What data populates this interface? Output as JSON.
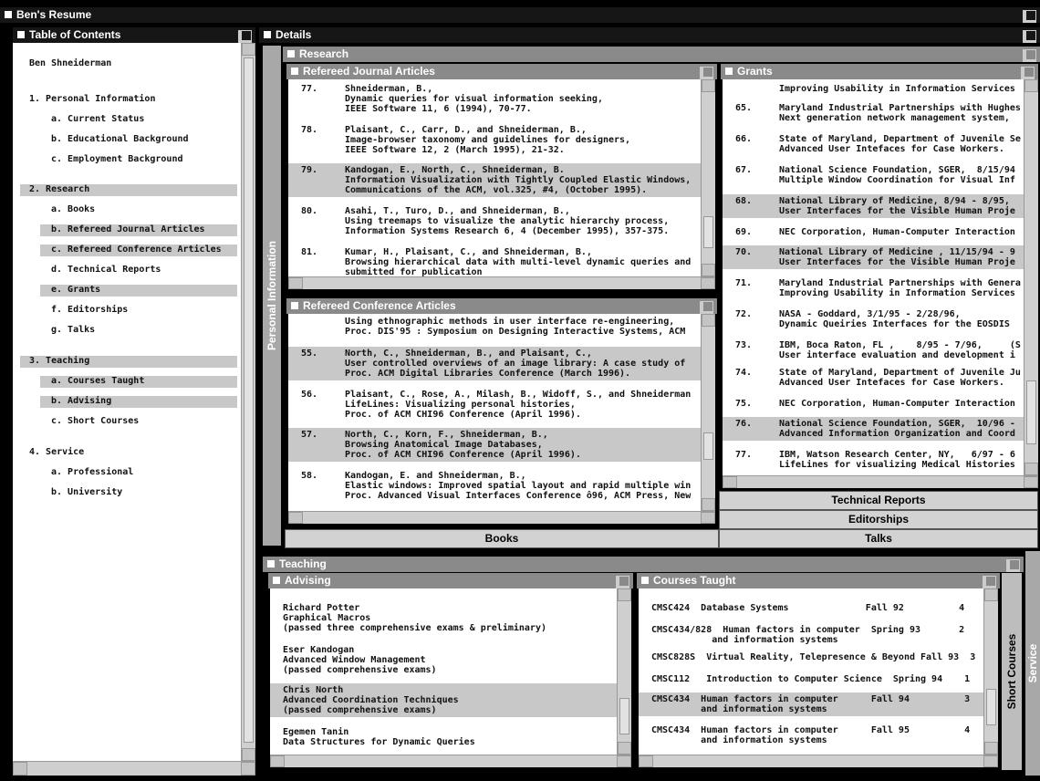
{
  "app": {
    "title": "Ben's Resume"
  },
  "toc": {
    "title": "Table of Contents",
    "name": "Ben Shneiderman",
    "items": [
      {
        "label": "1. Personal Information",
        "hl": false,
        "lvl": 0
      },
      {
        "label": "a. Current Status",
        "hl": false,
        "lvl": 1
      },
      {
        "label": "b. Educational Background",
        "hl": false,
        "lvl": 1
      },
      {
        "label": "c. Employment Background",
        "hl": false,
        "lvl": 1
      },
      {
        "label": "2. Research",
        "hl": true,
        "lvl": 0
      },
      {
        "label": "a. Books",
        "hl": false,
        "lvl": 1
      },
      {
        "label": "b. Refereed Journal Articles",
        "hl": true,
        "lvl": 1
      },
      {
        "label": "c. Refereed Conference Articles",
        "hl": true,
        "lvl": 1
      },
      {
        "label": "d. Technical Reports",
        "hl": false,
        "lvl": 1
      },
      {
        "label": "e. Grants",
        "hl": true,
        "lvl": 1
      },
      {
        "label": "f. Editorships",
        "hl": false,
        "lvl": 1
      },
      {
        "label": "g. Talks",
        "hl": false,
        "lvl": 1
      },
      {
        "label": "3. Teaching",
        "hl": true,
        "lvl": 0
      },
      {
        "label": "a. Courses Taught",
        "hl": true,
        "lvl": 1
      },
      {
        "label": "b. Advising",
        "hl": true,
        "lvl": 1
      },
      {
        "label": "c. Short Courses",
        "hl": false,
        "lvl": 1
      },
      {
        "label": "4. Service",
        "hl": false,
        "lvl": 0
      },
      {
        "label": "a. Professional",
        "hl": false,
        "lvl": 1
      },
      {
        "label": "b. University",
        "hl": false,
        "lvl": 1
      }
    ]
  },
  "details": {
    "title": "Details",
    "personal_tab": "Personal Information"
  },
  "research": {
    "title": "Research",
    "journal": {
      "title": "Refereed Journal Articles",
      "entries": [
        {
          "num": "77.",
          "hl": false,
          "lines": [
            "Shneiderman, B.,",
            "Dynamic queries for visual information seeking,",
            "IEEE Software 11, 6 (1994), 70-77."
          ]
        },
        {
          "num": "78.",
          "hl": false,
          "lines": [
            "Plaisant, C., Carr, D., and Shneiderman, B.,",
            "Image-browser taxonomy and guidelines for designers,",
            "IEEE Software 12, 2 (March 1995), 21-32."
          ]
        },
        {
          "num": "79.",
          "hl": true,
          "lines": [
            "Kandogan, E., North, C., Shneiderman, B.",
            "Information Visualization with Tightly Coupled Elastic Windows,",
            "Communications of the ACM, vol.325, #4, (October 1995)."
          ]
        },
        {
          "num": "80.",
          "hl": false,
          "lines": [
            "Asahi, T., Turo, D., and Shneiderman, B.,",
            "Using treemaps to visualize the analytic hierarchy process,",
            "Information Systems Research 6, 4 (December 1995), 357-375."
          ]
        },
        {
          "num": "81.",
          "hl": false,
          "lines": [
            "Kumar, H., Plaisant, C., and Shneiderman, B.,",
            "Browsing hierarchical data with multi-level dynamic queries and",
            "submitted for publication"
          ]
        }
      ]
    },
    "conference": {
      "title": "Refereed Conference Articles",
      "entries": [
        {
          "num": "",
          "hl": false,
          "lines": [
            "Using ethnographic methods in user interface re-engineering,",
            "Proc. DIS'95 : Symposium on Designing Interactive Systems, ACM"
          ]
        },
        {
          "num": "55.",
          "hl": true,
          "lines": [
            "North, C., Shneiderman, B., and Plaisant, C.,",
            "User controlled overviews of an image library: A case study of",
            "Proc. ACM Digital Libraries Conference (March 1996)."
          ]
        },
        {
          "num": "56.",
          "hl": false,
          "lines": [
            "Plaisant, C., Rose, A., Milash, B., Widoff, S., and Shneiderman",
            "LifeLines: Visualizing personal histories,",
            "Proc. of ACM CHI96 Conference (April 1996)."
          ]
        },
        {
          "num": "57.",
          "hl": true,
          "lines": [
            "North, C., Korn, F., Shneiderman, B.,",
            "Browsing Anatomical Image Databases,",
            "Proc. of ACM CHI96 Conference (April 1996)."
          ]
        },
        {
          "num": "58.",
          "hl": false,
          "lines": [
            "Kandogan, E. and Shneiderman, B.,",
            "Elastic windows: Improved spatial layout and rapid multiple win",
            "Proc. Advanced Visual Interfaces Conference ô96, ACM Press, New"
          ]
        }
      ]
    },
    "grants": {
      "title": "Grants",
      "entries": [
        {
          "num": "",
          "hl": false,
          "lines": [
            "Improving Usability in Information Services"
          ]
        },
        {
          "num": "65.",
          "hl": false,
          "lines": [
            "Maryland Industrial Partnerships with Hughes",
            "Next generation network management system,"
          ]
        },
        {
          "num": "66.",
          "hl": false,
          "lines": [
            "State of Maryland, Department of Juvenile Se",
            "Advanced User Intefaces for Case Workers."
          ]
        },
        {
          "num": "67.",
          "hl": false,
          "lines": [
            "National Science Foundation, SGER,  8/15/94",
            "Multiple Window Coordination for Visual Inf"
          ]
        },
        {
          "num": "68.",
          "hl": true,
          "lines": [
            "National Library of Medicine, 8/94 - 8/95,",
            "User Interfaces for the Visible Human Proje"
          ]
        },
        {
          "num": "69.",
          "hl": false,
          "lines": [
            "NEC Corporation, Human-Computer Interaction"
          ]
        },
        {
          "num": "70.",
          "hl": true,
          "lines": [
            "National Library of Medicine , 11/15/94 - 9",
            "User Interfaces for the Visible Human Proje"
          ]
        },
        {
          "num": "71.",
          "hl": false,
          "lines": [
            "Maryland Industrial Partnerships with Genera",
            "Improving Usability in Information Services"
          ]
        },
        {
          "num": "72.",
          "hl": false,
          "lines": [
            "NASA - Goddard, 3/1/95 - 2/28/96,",
            "Dynamic Queiries Interfaces for the EOSDIS"
          ]
        },
        {
          "num": "73.",
          "hl": false,
          "lines": [
            "IBM, Boca Raton, FL ,    8/95 - 7/96,     (S",
            "User interface evaluation and development i"
          ]
        },
        {
          "num": "74.",
          "hl": false,
          "lines": [
            "State of Maryland, Department of Juvenile Ju",
            "Advanced User Intefaces for Case Workers."
          ]
        },
        {
          "num": "75.",
          "hl": false,
          "lines": [
            "NEC Corporation, Human-Computer Interaction"
          ]
        },
        {
          "num": "76.",
          "hl": true,
          "lines": [
            "National Science Foundation, SGER,  10/96 -",
            "Advanced Information Organization and Coord"
          ]
        },
        {
          "num": "77.",
          "hl": false,
          "lines": [
            "IBM, Watson Research Center, NY,   6/97 - 6",
            "LifeLines for visualizing Medical Histories"
          ]
        }
      ]
    },
    "tabs": {
      "books": "Books",
      "technical_reports": "Technical Reports",
      "editorships": "Editorships",
      "talks": "Talks"
    }
  },
  "teaching": {
    "title": "Teaching",
    "advising": {
      "title": "Advising",
      "entries": [
        {
          "hl": false,
          "lines": [
            "Richard Potter",
            "Graphical Macros",
            "(passed three comprehensive exams & preliminary)"
          ]
        },
        {
          "hl": false,
          "lines": [
            "Eser Kandogan",
            "Advanced Window Management",
            "(passed comprehensive exams)"
          ]
        },
        {
          "hl": true,
          "lines": [
            "Chris North",
            "Advanced Coordination Techniques",
            "(passed comprehensive exams)"
          ]
        },
        {
          "hl": false,
          "lines": [
            "Egemen Tanin",
            "Data Structures for Dynamic Queries"
          ]
        }
      ]
    },
    "courses": {
      "title": "Courses Taught",
      "entries": [
        {
          "hl": false,
          "lines": [
            "CMSC424  Database Systems              Fall 92          4"
          ]
        },
        {
          "hl": false,
          "lines": [
            "CMSC434/828  Human factors in computer  Spring 93       2",
            "           and information systems"
          ]
        },
        {
          "hl": false,
          "lines": [
            "CMSC828S  Virtual Reality, Telepresence & Beyond Fall 93  3"
          ]
        },
        {
          "hl": false,
          "lines": [
            "CMSC112   Introduction to Computer Science  Spring 94    1"
          ]
        },
        {
          "hl": true,
          "lines": [
            "CMSC434  Human factors in computer      Fall 94          3",
            "         and information systems"
          ]
        },
        {
          "hl": false,
          "lines": [
            "CMSC434  Human factors in computer      Fall 95          4",
            "         and information systems"
          ]
        }
      ]
    },
    "short_courses_tab": "Short Courses"
  },
  "service_tab": "Service"
}
